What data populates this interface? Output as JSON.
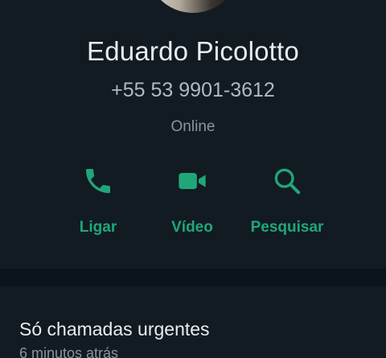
{
  "contact": {
    "name": "Eduardo Picolotto",
    "phone": "+55 53 9901-3612",
    "status": "Online"
  },
  "actions": [
    {
      "label": "Ligar",
      "icon": "phone-icon"
    },
    {
      "label": "Vídeo",
      "icon": "video-camera-icon"
    },
    {
      "label": "Pesquisar",
      "icon": "search-icon"
    }
  ],
  "about": {
    "text": "Só chamadas urgentes",
    "time": "6 minutos atrás"
  },
  "colors": {
    "accent": "#1fa77a",
    "background": "#0b141a",
    "card": "#121b22",
    "primary_text": "#e9edef",
    "secondary_text": "#8696a0"
  }
}
